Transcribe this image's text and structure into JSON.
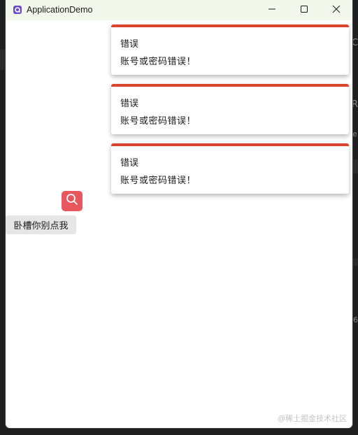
{
  "window": {
    "title": "ApplicationDemo",
    "app_icon": "app-logo-icon",
    "controls": [
      "minimize-icon",
      "maximize-icon",
      "close-icon"
    ]
  },
  "notifications": [
    {
      "title": "错误",
      "message": "账号或密码错误！"
    },
    {
      "title": "错误",
      "message": "账号或密码错误！"
    },
    {
      "title": "错误",
      "message": "账号或密码错误！"
    }
  ],
  "content": {
    "search_icon": "search-icon",
    "action_button_label": "卧槽你别点我"
  },
  "watermark": "@稀土掘金技术社区",
  "background_fragments": [
    "C",
    "R",
    "e",
    "6"
  ],
  "colors": {
    "accent_red": "#d9452b",
    "search_button": "#e8575d",
    "titlebar": "#f3f8ec",
    "app_icon": "#6b4bc9"
  }
}
